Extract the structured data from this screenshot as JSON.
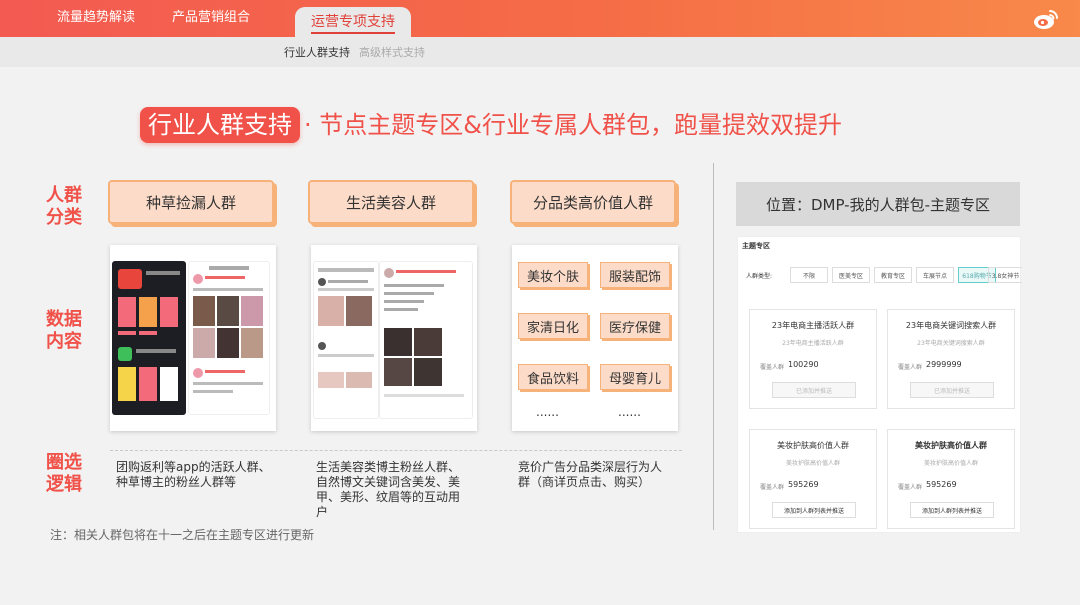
{
  "nav": {
    "tabs": [
      "流量趋势解读",
      "产品营销组合",
      "运营专项支持"
    ],
    "active_tab": "运营专项支持"
  },
  "subnav": {
    "items": [
      "行业人群支持",
      "高级样式支持"
    ],
    "active": "行业人群支持"
  },
  "headline": {
    "badge": "行业人群支持",
    "text": "· 节点主题专区&行业专属人群包，跑量提效双提升"
  },
  "row_labels": {
    "category": "人群\n分类",
    "data": "数据\n内容",
    "logic": "圈选\n逻辑"
  },
  "categories": [
    "种草捡漏人群",
    "生活美容人群",
    "分品类高价值人群"
  ],
  "logic": [
    "团购返利等app的活跃人群、种草博主的粉丝人群等",
    "生活美容类博主粉丝人群、自然博文关键词含美发、美甲、美形、纹眉等的互动用户",
    "竞价广告分品类深层行为人群（商详页点击、购买）"
  ],
  "high_value_grid": [
    "美妆个肤",
    "服装配饰",
    "家清日化",
    "医疗保健",
    "食品饮料",
    "母婴育儿"
  ],
  "ellipsis": "......",
  "note": "注：相关人群包将在十一之后在主题专区进行更新",
  "position_label": "位置：DMP-我的人群包-主题专区",
  "dmp": {
    "header": "主题专区",
    "filter_label": "人群类型:",
    "chips": [
      "不限",
      "医美专区",
      "教育专区",
      "车展节点",
      "618购物节",
      "3.8女神节"
    ],
    "selected_chip": "618购物节",
    "cards": [
      {
        "title": "23年电商主播活跃人群",
        "sub": "23年电商主播活跃人群",
        "count_label": "覆盖人群",
        "count": "100290",
        "button": "已添加并推送",
        "enabled": false
      },
      {
        "title": "23年电商关键词搜索人群",
        "sub": "23年电商关键词搜索人群",
        "count_label": "覆盖人群",
        "count": "2999999",
        "button": "已添加并推送",
        "enabled": false
      },
      {
        "title": "美妆护肤高价值人群",
        "sub": "美妆护肤高价值人群",
        "count_label": "覆盖人群",
        "count": "595269",
        "button": "添加到人群列表并推送",
        "enabled": true
      },
      {
        "title": "美妆护肤高价值人群",
        "sub": "美妆护肤高价值人群",
        "count_label": "覆盖人群",
        "count": "595269",
        "button": "添加到人群列表并推送",
        "enabled": true
      }
    ]
  },
  "colors": {
    "brand": "#f0524a",
    "accent_bg": "#fcdcc9",
    "accent_border": "#f7b27a"
  }
}
